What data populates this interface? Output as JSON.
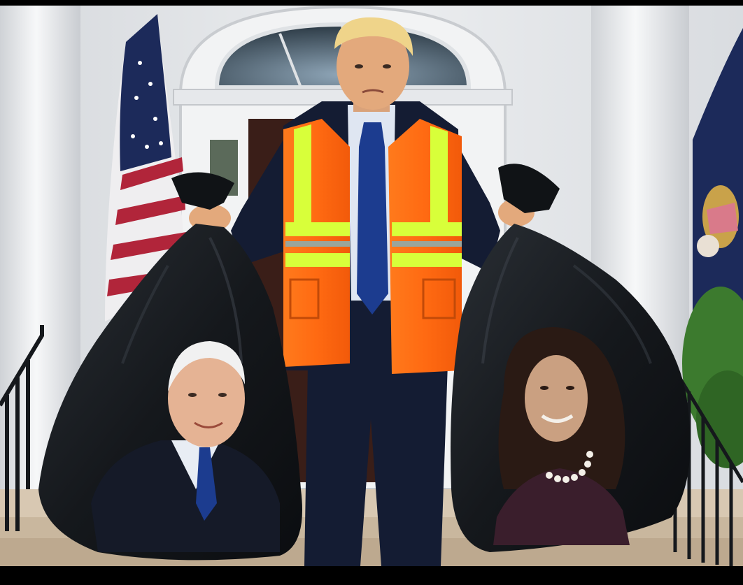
{
  "scene": {
    "setting": "white-house-portico",
    "figures": [
      "man-in-safety-vest",
      "bag-left-portrait",
      "bag-right-portrait"
    ],
    "colors": {
      "vest_orange": "#ff6a12",
      "vest_stripe": "#d8ff3a",
      "suit_navy": "#141c33",
      "tie_blue": "#1c3c8f",
      "bag_black": "#15181c",
      "wall_white": "#e9ebee",
      "flag_red": "#b1253a",
      "flag_blue": "#1c2a5a",
      "hedge_green": "#3c7a2e",
      "frame_black": "#000000"
    }
  }
}
